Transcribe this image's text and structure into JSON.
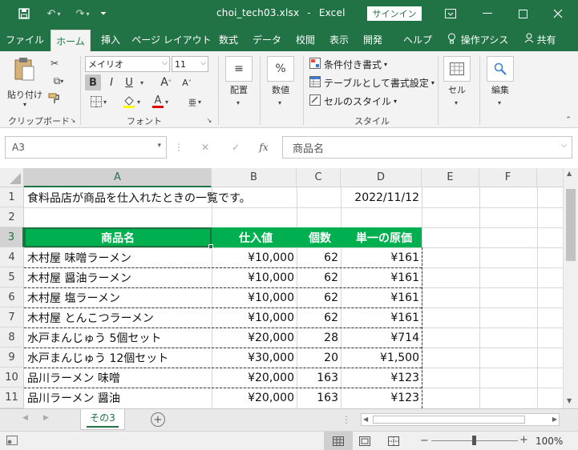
{
  "titlebar": {
    "filename": "choi_tech03.xlsx",
    "separator": "-",
    "app": "Excel",
    "signin": "サインイン"
  },
  "tabs": [
    "ファイル",
    "ホーム",
    "挿入",
    "ページ レイアウト",
    "数式",
    "データ",
    "校閲",
    "表示",
    "開発",
    "ヘルプ"
  ],
  "tell_me": "操作アシス",
  "share": "共有",
  "ribbon": {
    "paste": "貼り付け",
    "clipboard_label": "クリップボード",
    "font_name": "メイリオ",
    "font_size": "11",
    "bold": "B",
    "italic": "I",
    "underline": "U",
    "grow_font": "A",
    "shrink_font": "A",
    "font_color_letter": "A",
    "font_label": "フォント",
    "alignment": "配置",
    "number": "数値",
    "percent": "%",
    "cond_format": "条件付き書式",
    "format_table": "テーブルとして書式設定",
    "cell_styles": "セルのスタイル",
    "styles_label": "スタイル",
    "cells": "セル",
    "editing": "編集"
  },
  "formula_bar": {
    "name_box": "A3",
    "fx": "fx",
    "content": "商品名"
  },
  "columns": [
    "A",
    "B",
    "C",
    "D",
    "E",
    "F"
  ],
  "rows": [
    "1",
    "2",
    "3",
    "4",
    "5",
    "6",
    "7",
    "8",
    "9",
    "10",
    "11"
  ],
  "sheet": {
    "a1": "食料品店が商品を仕入れたときの一覧です。",
    "d1": "2022/11/12",
    "headers": [
      "商品名",
      "仕入値",
      "個数",
      "単一の原価"
    ],
    "data": [
      [
        "木村屋 味噌ラーメン",
        "¥10,000",
        "62",
        "¥161"
      ],
      [
        "木村屋 醤油ラーメン",
        "¥10,000",
        "62",
        "¥161"
      ],
      [
        "木村屋 塩ラーメン",
        "¥10,000",
        "62",
        "¥161"
      ],
      [
        "木村屋 とんこつラーメン",
        "¥10,000",
        "62",
        "¥161"
      ],
      [
        "水戸まんじゅう 5個セット",
        "¥20,000",
        "28",
        "¥714"
      ],
      [
        "水戸まんじゅう 12個セット",
        "¥30,000",
        "20",
        "¥1,500"
      ],
      [
        "品川ラーメン 味噌",
        "¥20,000",
        "163",
        "¥123"
      ],
      [
        "品川ラーメン 醤油",
        "¥20,000",
        "163",
        "¥123"
      ]
    ]
  },
  "sheet_tab": "その3",
  "zoom": "100%",
  "colors": {
    "excel_green": "#217346",
    "header_fill": "#00b050"
  }
}
